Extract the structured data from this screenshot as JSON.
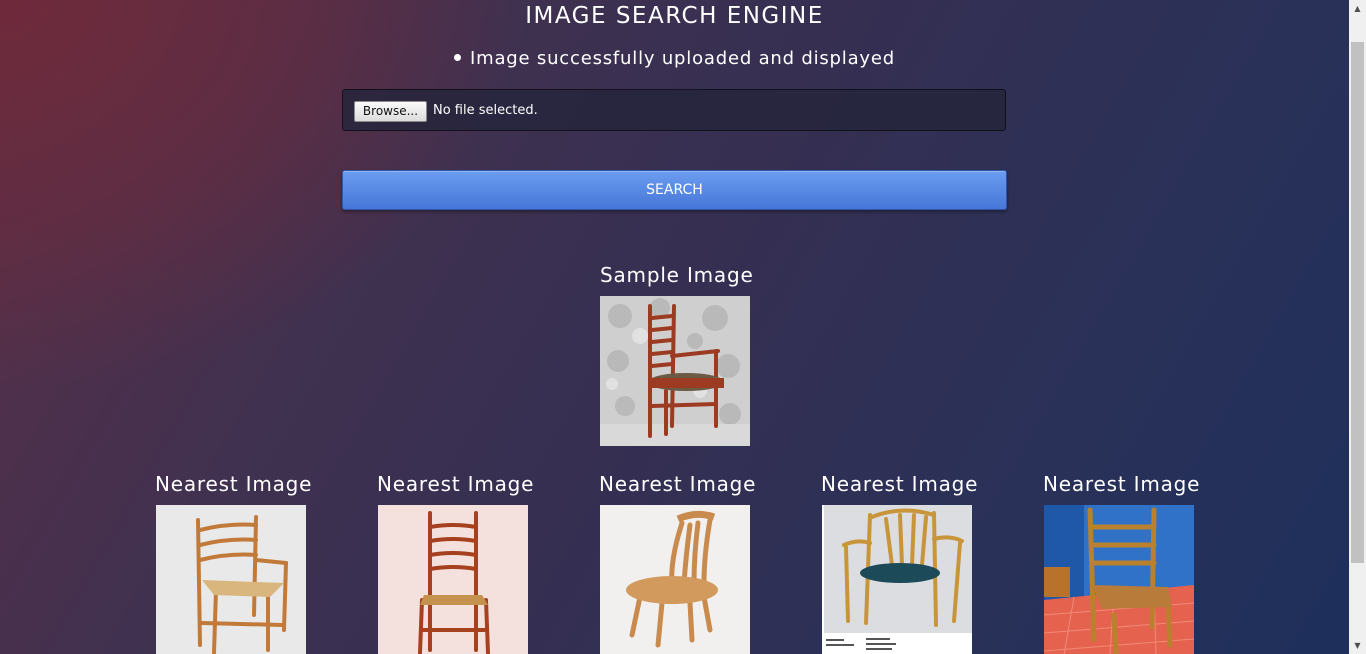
{
  "header": {
    "title": "IMAGE SEARCH ENGINE",
    "status_message": "Image successfully uploaded and displayed"
  },
  "upload": {
    "browse_label": "Browse...",
    "file_status": "No file selected."
  },
  "search": {
    "button_label": "SEARCH"
  },
  "sample": {
    "label": "Sample Image"
  },
  "results": [
    {
      "label": "Nearest Image"
    },
    {
      "label": "Nearest Image"
    },
    {
      "label": "Nearest Image"
    },
    {
      "label": "Nearest Image"
    },
    {
      "label": "Nearest Image"
    }
  ],
  "colors": {
    "search_button": "#5588e6",
    "background_dark": "#2a3158",
    "background_warm": "#702a3a"
  },
  "icons": {
    "scroll_up": "scroll-up-arrow-icon",
    "scroll_down": "scroll-down-arrow-icon",
    "status_bullet": "bullet-icon"
  }
}
